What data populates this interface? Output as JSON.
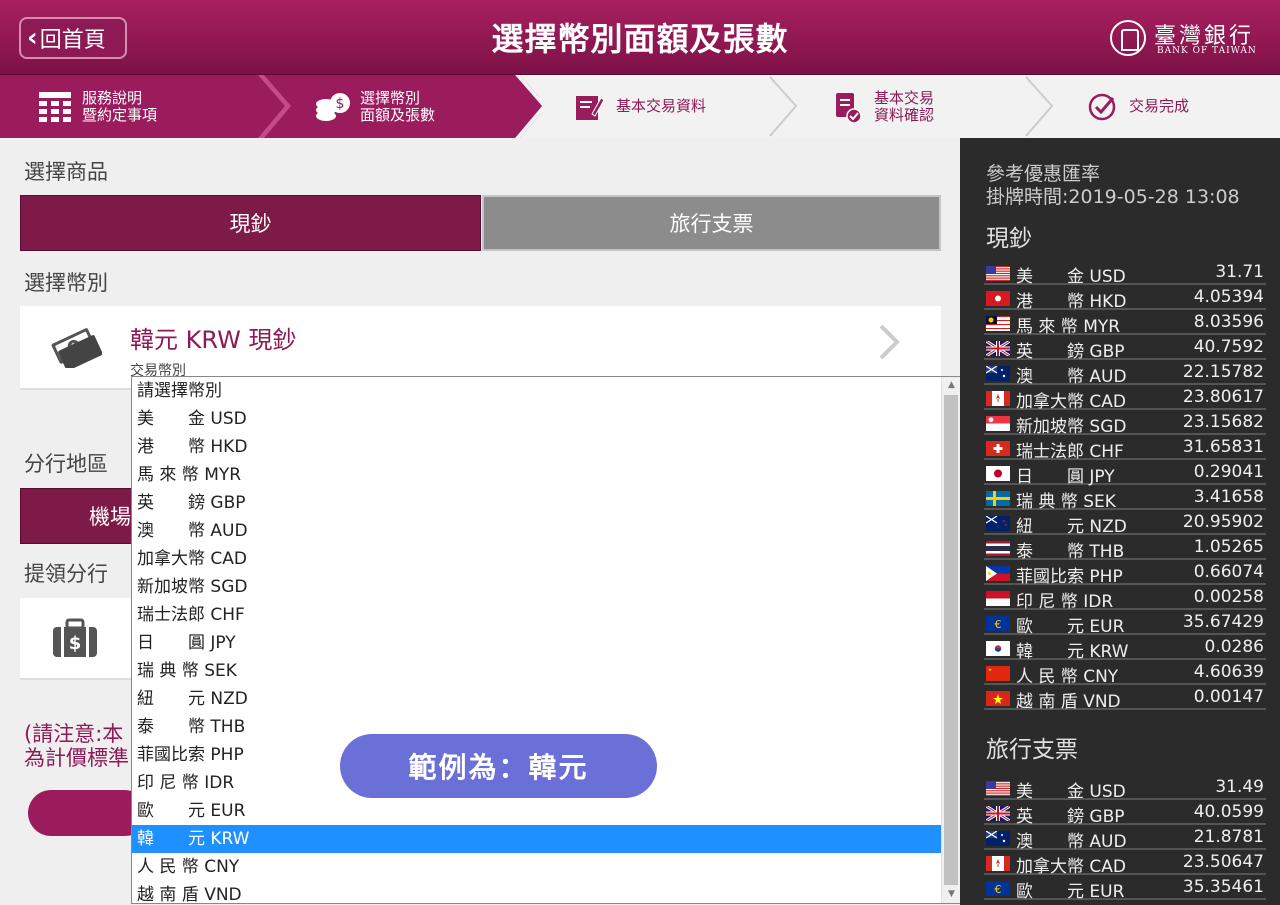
{
  "header": {
    "back_label": "回首頁",
    "title": "選擇幣別面額及張數",
    "logo_name": "臺灣銀行",
    "logo_en": "BANK OF TAIWAN"
  },
  "steps": [
    {
      "line1": "服務說明",
      "line2": "暨約定事項",
      "state": "done",
      "icon": "calculator-grid-icon"
    },
    {
      "line1": "選擇幣別",
      "line2": "面額及張數",
      "state": "done",
      "icon": "coins-icon"
    },
    {
      "line1": "基本交易資料",
      "line2": "",
      "state": "todo",
      "icon": "edit-form-icon"
    },
    {
      "line1": "基本交易",
      "line2": "資料確認",
      "state": "todo",
      "icon": "document-check-icon"
    },
    {
      "line1": "交易完成",
      "line2": "",
      "state": "todo",
      "icon": "check-circle-icon"
    }
  ],
  "product": {
    "label": "選擇商品",
    "tabs": [
      "現鈔",
      "旅行支票"
    ]
  },
  "currency": {
    "label": "選擇幣別",
    "selected": "韓元 KRW 現鈔",
    "sub_label": "交易幣別"
  },
  "branch": {
    "region_label": "分行地區",
    "region_tab": "機場",
    "pickup_label": "提領分行"
  },
  "note": {
    "line1": "(請注意:本",
    "line2": "為計價標準"
  },
  "dropdown": {
    "items": [
      "請選擇幣別",
      "美　　金 USD",
      "港　　幣 HKD",
      "馬 來 幣 MYR",
      "英　　鎊 GBP",
      "澳　　幣 AUD",
      "加拿大幣 CAD",
      "新加坡幣 SGD",
      "瑞士法郎 CHF",
      "日　　圓 JPY",
      "瑞 典 幣 SEK",
      "紐　　元 NZD",
      "泰　　幣 THB",
      "菲國比索 PHP",
      "印 尼 幣 IDR",
      "歐　　元 EUR",
      "韓　　元 KRW",
      "人 民 幣 CNY",
      "越 南 盾 VND"
    ],
    "selected_index": 16
  },
  "example": "範例為：韓元",
  "rates": {
    "title": "參考優惠匯率",
    "time": "掛牌時間:2019-05-28 13:08",
    "cash_label": "現鈔",
    "cash": [
      {
        "name": "美　　金 USD",
        "value": "31.71",
        "flag": "us-flag-icon"
      },
      {
        "name": "港　　幣 HKD",
        "value": "4.05394",
        "flag": "hk-flag-icon"
      },
      {
        "name": "馬 來 幣 MYR",
        "value": "8.03596",
        "flag": "my-flag-icon"
      },
      {
        "name": "英　　鎊 GBP",
        "value": "40.7592",
        "flag": "uk-flag-icon"
      },
      {
        "name": "澳　　幣 AUD",
        "value": "22.15782",
        "flag": "au-flag-icon"
      },
      {
        "name": "加拿大幣 CAD",
        "value": "23.80617",
        "flag": "ca-flag-icon"
      },
      {
        "name": "新加坡幣 SGD",
        "value": "23.15682",
        "flag": "sg-flag-icon"
      },
      {
        "name": "瑞士法郎 CHF",
        "value": "31.65831",
        "flag": "ch-flag-icon"
      },
      {
        "name": "日　　圓 JPY",
        "value": "0.29041",
        "flag": "jp-flag-icon"
      },
      {
        "name": "瑞 典 幣 SEK",
        "value": "3.41658",
        "flag": "se-flag-icon"
      },
      {
        "name": "紐　　元 NZD",
        "value": "20.95902",
        "flag": "nz-flag-icon"
      },
      {
        "name": "泰　　幣 THB",
        "value": "1.05265",
        "flag": "th-flag-icon"
      },
      {
        "name": "菲國比索 PHP",
        "value": "0.66074",
        "flag": "ph-flag-icon"
      },
      {
        "name": "印 尼 幣 IDR",
        "value": "0.00258",
        "flag": "id-flag-icon"
      },
      {
        "name": "歐　　元 EUR",
        "value": "35.67429",
        "flag": "eu-flag-icon"
      },
      {
        "name": "韓　　元 KRW",
        "value": "0.0286",
        "flag": "kr-flag-icon"
      },
      {
        "name": "人 民 幣 CNY",
        "value": "4.60639",
        "flag": "cn-flag-icon"
      },
      {
        "name": "越 南 盾 VND",
        "value": "0.00147",
        "flag": "vn-flag-icon"
      }
    ],
    "tc_label": "旅行支票",
    "tc": [
      {
        "name": "美　　金 USD",
        "value": "31.49",
        "flag": "us-flag-icon"
      },
      {
        "name": "英　　鎊 GBP",
        "value": "40.0599",
        "flag": "uk-flag-icon"
      },
      {
        "name": "澳　　幣 AUD",
        "value": "21.8781",
        "flag": "au-flag-icon"
      },
      {
        "name": "加拿大幣 CAD",
        "value": "23.50647",
        "flag": "ca-flag-icon"
      },
      {
        "name": "歐　　元 EUR",
        "value": "35.35461",
        "flag": "eu-flag-icon"
      }
    ]
  }
}
